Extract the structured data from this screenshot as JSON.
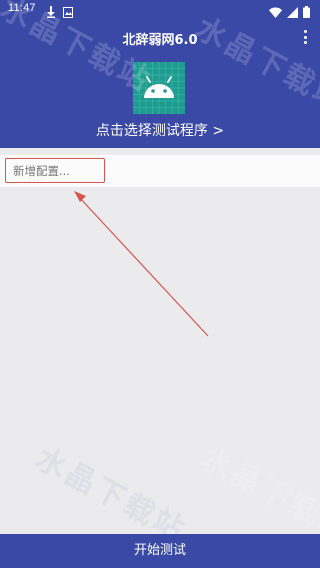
{
  "status_bar": {
    "time": "11:47"
  },
  "app": {
    "title": "北辞弱网6.0",
    "select_program": "点击选择测试程序 >"
  },
  "config": {
    "new_config_label": "新增配置..."
  },
  "bottom": {
    "start_test_label": "开始测试"
  },
  "watermark": {
    "text": "水晶下载站"
  },
  "colors": {
    "primary": "#3a49a6",
    "android_bg": "#1f9c8f",
    "annotation": "#d9534f"
  },
  "icons": {
    "download": "download-icon",
    "image": "image-icon",
    "wifi": "wifi-icon",
    "signal": "signal-icon",
    "battery": "battery-icon",
    "menu": "overflow-menu-icon",
    "app": "android-icon"
  }
}
